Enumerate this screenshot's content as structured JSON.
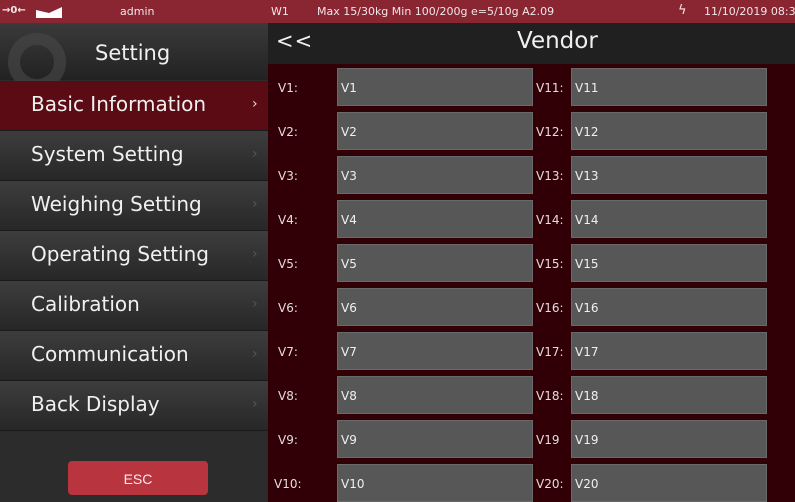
{
  "status": {
    "zero_indicator": "→0←",
    "user": "admin",
    "scale": "W1",
    "spec": "Max 15/30kg  Min 100/200g e=5/10g A2.09",
    "datetime": "11/10/2019 08:3"
  },
  "sidebar": {
    "title": "Setting",
    "items": [
      {
        "label": "Basic Information"
      },
      {
        "label": "System Setting"
      },
      {
        "label": "Weighing Setting"
      },
      {
        "label": "Operating Setting"
      },
      {
        "label": "Calibration"
      },
      {
        "label": "Communication"
      },
      {
        "label": "Back Display"
      }
    ],
    "esc_label": "ESC"
  },
  "header": {
    "back_label": "<<",
    "title": "Vendor"
  },
  "fields": [
    {
      "label": "V1:",
      "value": "V1"
    },
    {
      "label": "V2:",
      "value": "V2"
    },
    {
      "label": "V3:",
      "value": "V3"
    },
    {
      "label": "V4:",
      "value": "V4"
    },
    {
      "label": "V5:",
      "value": "V5"
    },
    {
      "label": "V6:",
      "value": "V6"
    },
    {
      "label": "V7:",
      "value": "V7"
    },
    {
      "label": "V8:",
      "value": "V8"
    },
    {
      "label": "V9:",
      "value": "V9"
    },
    {
      "label": "V10:",
      "value": "V10"
    },
    {
      "label": "V11:",
      "value": "V11"
    },
    {
      "label": "V12:",
      "value": "V12"
    },
    {
      "label": "V13:",
      "value": "V13"
    },
    {
      "label": "V14:",
      "value": "V14"
    },
    {
      "label": "V15:",
      "value": "V15"
    },
    {
      "label": "V16:",
      "value": "V16"
    },
    {
      "label": "V17:",
      "value": "V17"
    },
    {
      "label": "V18:",
      "value": "V18"
    },
    {
      "label": "V19",
      "value": "V19"
    },
    {
      "label": "V20:",
      "value": "V20"
    }
  ]
}
